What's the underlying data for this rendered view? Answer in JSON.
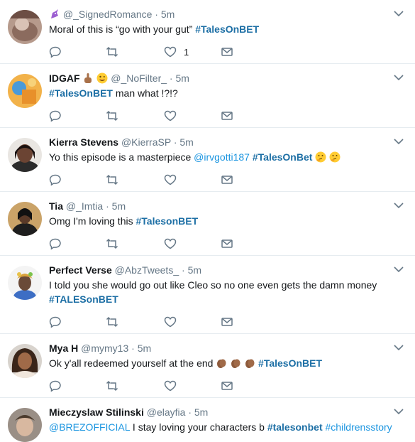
{
  "tweets": [
    {
      "name": "",
      "handle": "@_SignedRomance",
      "time": "5m",
      "text_parts": [
        "Moral of this is “go with your gut” "
      ],
      "hashtag": "#TalesOnBET",
      "like_count": "1",
      "avatar_icon": "unicorn-emoji"
    },
    {
      "name": "IDGAF",
      "handle": "@_NoFilter_",
      "time": "5m",
      "hashtag": "#TalesOnBET",
      "text_after": " man what !?!?"
    },
    {
      "name": "Kierra Stevens",
      "handle": "@KierraSP",
      "time": "5m",
      "text_before": "Yo this episode is a masterpiece ",
      "mention": "@irvgotti187",
      "hashtag": "#TalesOnBet"
    },
    {
      "name": "Tia",
      "handle": "@_Imtia",
      "time": "5m",
      "text_before": "Omg I'm loving this ",
      "hashtag": "#TalesonBET"
    },
    {
      "name": "Perfect Verse",
      "handle": "@AbzTweets_",
      "time": "5m",
      "text_before": "I told you she would go out like Cleo so no one even gets the damn money",
      "hashtag": "#TALESonBET"
    },
    {
      "name": "Mya H",
      "handle": "@mymy13",
      "time": "5m",
      "text_before": "Ok y'all redeemed yourself at the end ",
      "hashtag": "#TalesOnBET"
    },
    {
      "name": "Mieczyslaw Stilinski",
      "handle": "@elayfia",
      "time": "5m",
      "mention": "@BREZOFFICIAL",
      "text_middle": " I stay loving your characters b ",
      "hashtag": "#talesonbet",
      "hashtag2": "#childrensstory"
    }
  ],
  "dot": "·",
  "colors": {
    "link": "#1b95e0",
    "hashtag": "#1d6fa5",
    "muted": "#657786",
    "border": "#e6ecf0"
  }
}
